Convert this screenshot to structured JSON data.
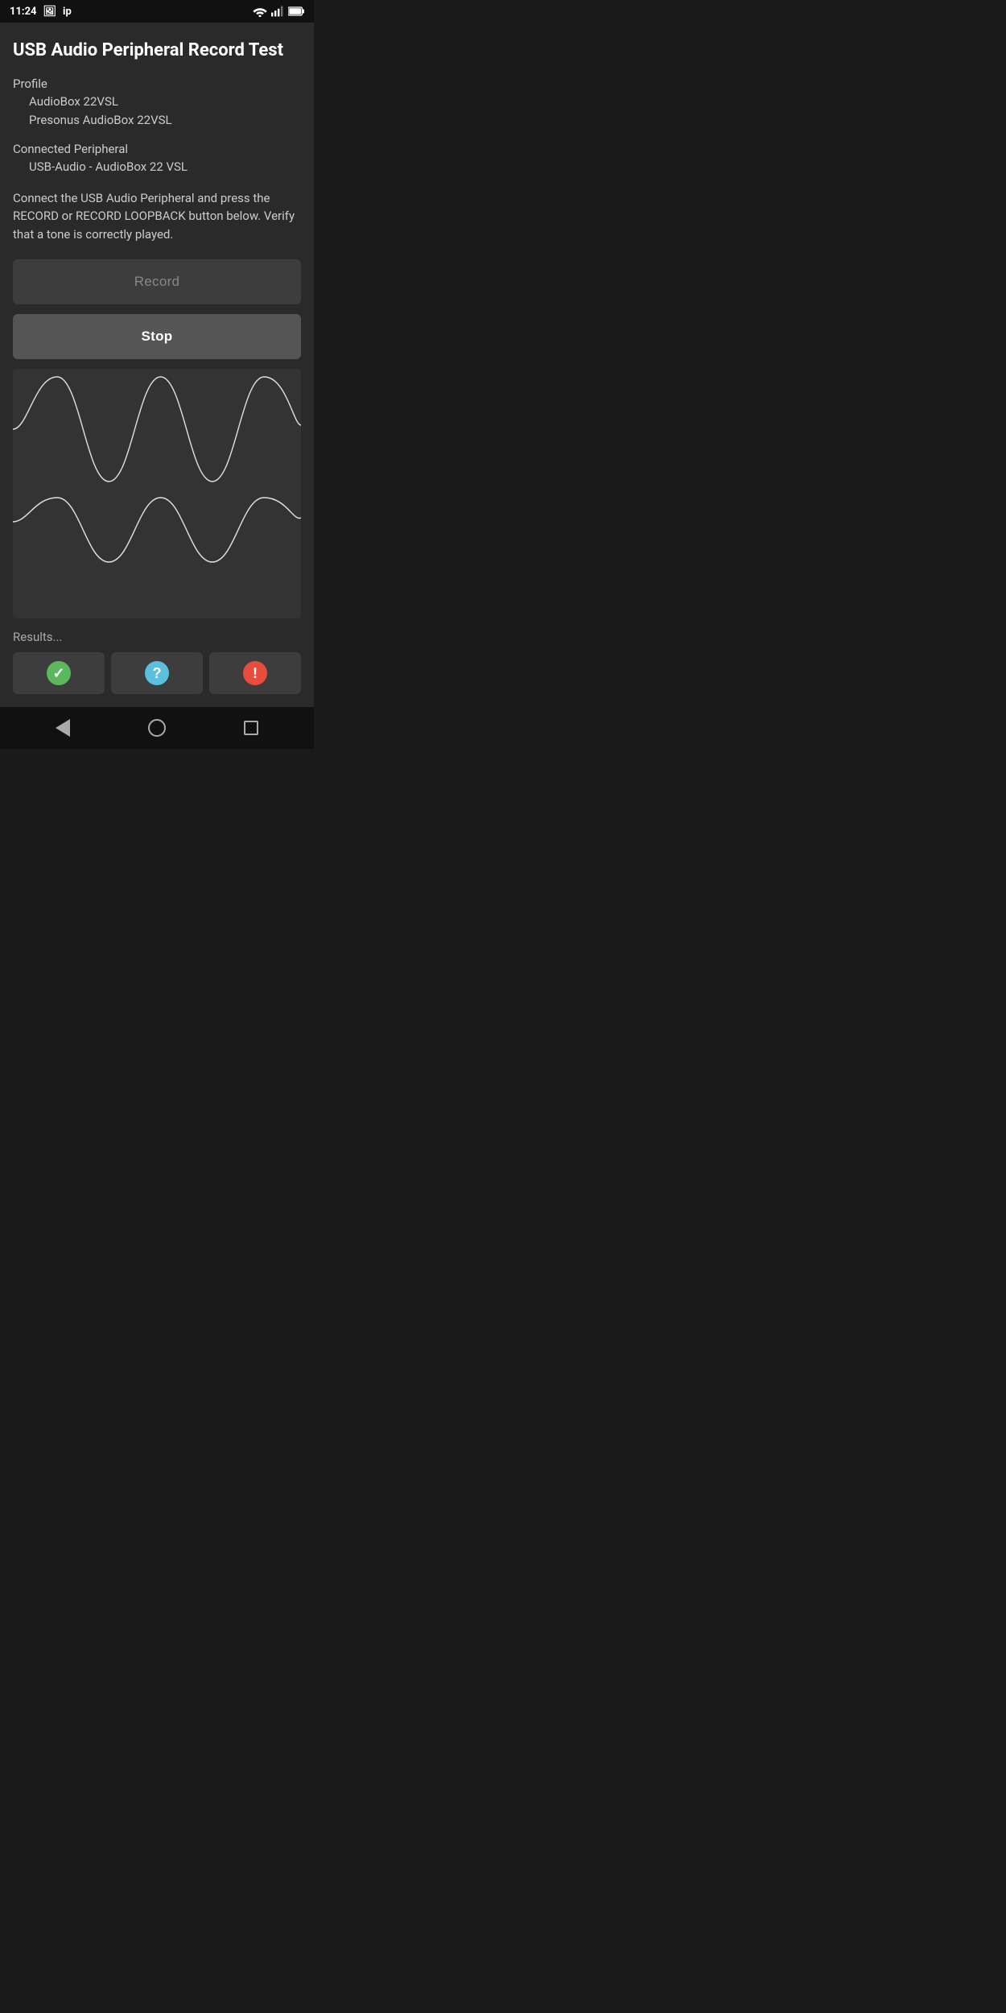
{
  "statusBar": {
    "time": "11:24",
    "icons": [
      "photo",
      "ip",
      "wifi",
      "signal",
      "battery"
    ]
  },
  "header": {
    "title": "USB Audio Peripheral Record Test"
  },
  "profile": {
    "label": "Profile",
    "name": "AudioBox 22VSL",
    "subname": "Presonus AudioBox 22VSL"
  },
  "peripheral": {
    "label": "Connected Peripheral",
    "name": "USB-Audio - AudioBox 22 VSL"
  },
  "instruction": "Connect the USB Audio Peripheral and press the RECORD or RECORD LOOPBACK button below. Verify that a tone is correctly played.",
  "buttons": {
    "record_label": "Record",
    "stop_label": "Stop"
  },
  "results": {
    "label": "Results...",
    "buttons": [
      {
        "type": "check",
        "label": "pass"
      },
      {
        "type": "question",
        "label": "unknown"
      },
      {
        "type": "exclamation",
        "label": "fail"
      }
    ]
  },
  "navigation": {
    "back_label": "back",
    "home_label": "home",
    "recents_label": "recents"
  }
}
